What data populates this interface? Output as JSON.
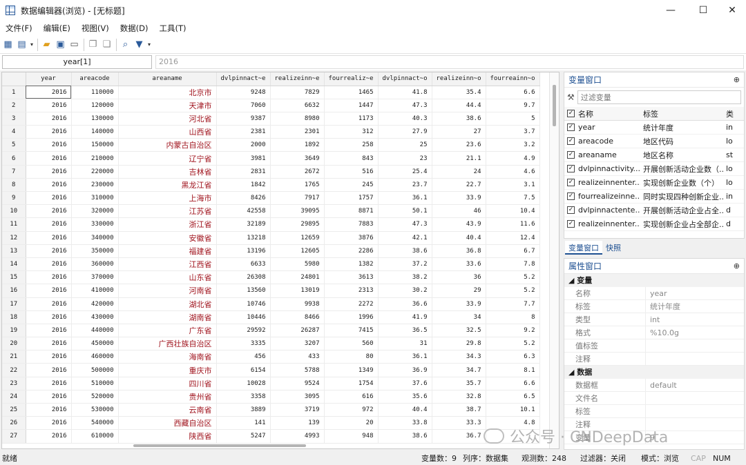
{
  "window": {
    "title": "数据编辑器(浏览) - [无标题]",
    "minimize": "—",
    "maximize": "☐",
    "close": "✕"
  },
  "menu": [
    "文件(F)",
    "编辑(E)",
    "视图(V)",
    "数据(D)",
    "工具(T)"
  ],
  "toolbar_icons": [
    "grid-view-icon",
    "edit-view-icon",
    "open-icon",
    "save-icon",
    "print-icon",
    "copy-icon",
    "paste-icon",
    "find-icon",
    "filter-icon"
  ],
  "cmd": {
    "varname": "year[1]",
    "value": "2016"
  },
  "grid": {
    "columns": [
      "year",
      "areacode",
      "areaname",
      "dvlpinnact~e",
      "realizeinn~e",
      "fourrealiz~e",
      "dvlpinnact~o",
      "realizeinn~o",
      "fourreainn~o"
    ],
    "rows": [
      [
        "1",
        "2016",
        "110000",
        "北京市",
        "9248",
        "7829",
        "1465",
        "41.8",
        "35.4",
        "6.6"
      ],
      [
        "2",
        "2016",
        "120000",
        "天津市",
        "7060",
        "6632",
        "1447",
        "47.3",
        "44.4",
        "9.7"
      ],
      [
        "3",
        "2016",
        "130000",
        "河北省",
        "9387",
        "8980",
        "1173",
        "40.3",
        "38.6",
        "5"
      ],
      [
        "4",
        "2016",
        "140000",
        "山西省",
        "2381",
        "2301",
        "312",
        "27.9",
        "27",
        "3.7"
      ],
      [
        "5",
        "2016",
        "150000",
        "内蒙古自治区",
        "2000",
        "1892",
        "258",
        "25",
        "23.6",
        "3.2"
      ],
      [
        "6",
        "2016",
        "210000",
        "辽宁省",
        "3981",
        "3649",
        "843",
        "23",
        "21.1",
        "4.9"
      ],
      [
        "7",
        "2016",
        "220000",
        "吉林省",
        "2831",
        "2672",
        "516",
        "25.4",
        "24",
        "4.6"
      ],
      [
        "8",
        "2016",
        "230000",
        "黑龙江省",
        "1842",
        "1765",
        "245",
        "23.7",
        "22.7",
        "3.1"
      ],
      [
        "9",
        "2016",
        "310000",
        "上海市",
        "8426",
        "7917",
        "1757",
        "36.1",
        "33.9",
        "7.5"
      ],
      [
        "10",
        "2016",
        "320000",
        "江苏省",
        "42558",
        "39095",
        "8871",
        "50.1",
        "46",
        "10.4"
      ],
      [
        "11",
        "2016",
        "330000",
        "浙江省",
        "32189",
        "29895",
        "7883",
        "47.3",
        "43.9",
        "11.6"
      ],
      [
        "12",
        "2016",
        "340000",
        "安徽省",
        "13218",
        "12659",
        "3876",
        "42.1",
        "40.4",
        "12.4"
      ],
      [
        "13",
        "2016",
        "350000",
        "福建省",
        "13196",
        "12605",
        "2286",
        "38.6",
        "36.8",
        "6.7"
      ],
      [
        "14",
        "2016",
        "360000",
        "江西省",
        "6633",
        "5980",
        "1382",
        "37.2",
        "33.6",
        "7.8"
      ],
      [
        "15",
        "2016",
        "370000",
        "山东省",
        "26308",
        "24801",
        "3613",
        "38.2",
        "36",
        "5.2"
      ],
      [
        "16",
        "2016",
        "410000",
        "河南省",
        "13560",
        "13019",
        "2313",
        "30.2",
        "29",
        "5.2"
      ],
      [
        "17",
        "2016",
        "420000",
        "湖北省",
        "10746",
        "9938",
        "2272",
        "36.6",
        "33.9",
        "7.7"
      ],
      [
        "18",
        "2016",
        "430000",
        "湖南省",
        "10446",
        "8466",
        "1996",
        "41.9",
        "34",
        "8"
      ],
      [
        "19",
        "2016",
        "440000",
        "广东省",
        "29592",
        "26287",
        "7415",
        "36.5",
        "32.5",
        "9.2"
      ],
      [
        "20",
        "2016",
        "450000",
        "广西壮族自治区",
        "3335",
        "3207",
        "560",
        "31",
        "29.8",
        "5.2"
      ],
      [
        "21",
        "2016",
        "460000",
        "海南省",
        "456",
        "433",
        "80",
        "36.1",
        "34.3",
        "6.3"
      ],
      [
        "22",
        "2016",
        "500000",
        "重庆市",
        "6154",
        "5788",
        "1349",
        "36.9",
        "34.7",
        "8.1"
      ],
      [
        "23",
        "2016",
        "510000",
        "四川省",
        "10028",
        "9524",
        "1754",
        "37.6",
        "35.7",
        "6.6"
      ],
      [
        "24",
        "2016",
        "520000",
        "贵州省",
        "3358",
        "3095",
        "616",
        "35.6",
        "32.8",
        "6.5"
      ],
      [
        "25",
        "2016",
        "530000",
        "云南省",
        "3889",
        "3719",
        "972",
        "40.4",
        "38.7",
        "10.1"
      ],
      [
        "26",
        "2016",
        "540000",
        "西藏自治区",
        "141",
        "139",
        "20",
        "33.8",
        "33.3",
        "4.8"
      ],
      [
        "27",
        "2016",
        "610000",
        "陕西省",
        "5247",
        "4993",
        "948",
        "38.6",
        "36.7",
        ""
      ]
    ]
  },
  "varwin": {
    "title": "变量窗口",
    "filter_placeholder": "过滤变量",
    "head": [
      "名称",
      "标签",
      "类"
    ],
    "vars": [
      [
        "year",
        "统计年度",
        "in"
      ],
      [
        "areacode",
        "地区代码",
        "lo"
      ],
      [
        "areaname",
        "地区名称",
        "st"
      ],
      [
        "dvlpinnactivity...",
        "开展创新活动企业数（...",
        "lo"
      ],
      [
        "realizeinnenter...",
        "实现创新企业数（个）",
        "lo"
      ],
      [
        "fourrealizeinne...",
        "同时实现四种创新企业...",
        "in"
      ],
      [
        "dvlpinnactente...",
        "开展创新活动企业占全...",
        "d"
      ],
      [
        "realizeinnenter...",
        "实现创新企业占全部企...",
        "d"
      ]
    ]
  },
  "tabs": [
    "变量窗口",
    "快照"
  ],
  "props": {
    "title": "属性窗口",
    "sec1": "变量",
    "rows1": [
      [
        "名称",
        "year"
      ],
      [
        "标签",
        "统计年度"
      ],
      [
        "类型",
        "int"
      ],
      [
        "格式",
        "%10.0g"
      ],
      [
        "值标签",
        ""
      ],
      [
        "注释",
        ""
      ]
    ],
    "sec2": "数据",
    "rows2": [
      [
        "数据框",
        "default"
      ],
      [
        "文件名",
        ""
      ],
      [
        "标签",
        ""
      ],
      [
        "注释",
        ""
      ],
      [
        "变量",
        "9"
      ]
    ]
  },
  "status": {
    "ready": "就绪",
    "vars": "变量数：9",
    "order": "列序：数据集",
    "obs": "观测数：248",
    "filter": "过滤器：关闭",
    "mode": "模式：浏览",
    "cap": "CAP",
    "num": "NUM"
  },
  "watermark": "公众号 · CNDeepData"
}
